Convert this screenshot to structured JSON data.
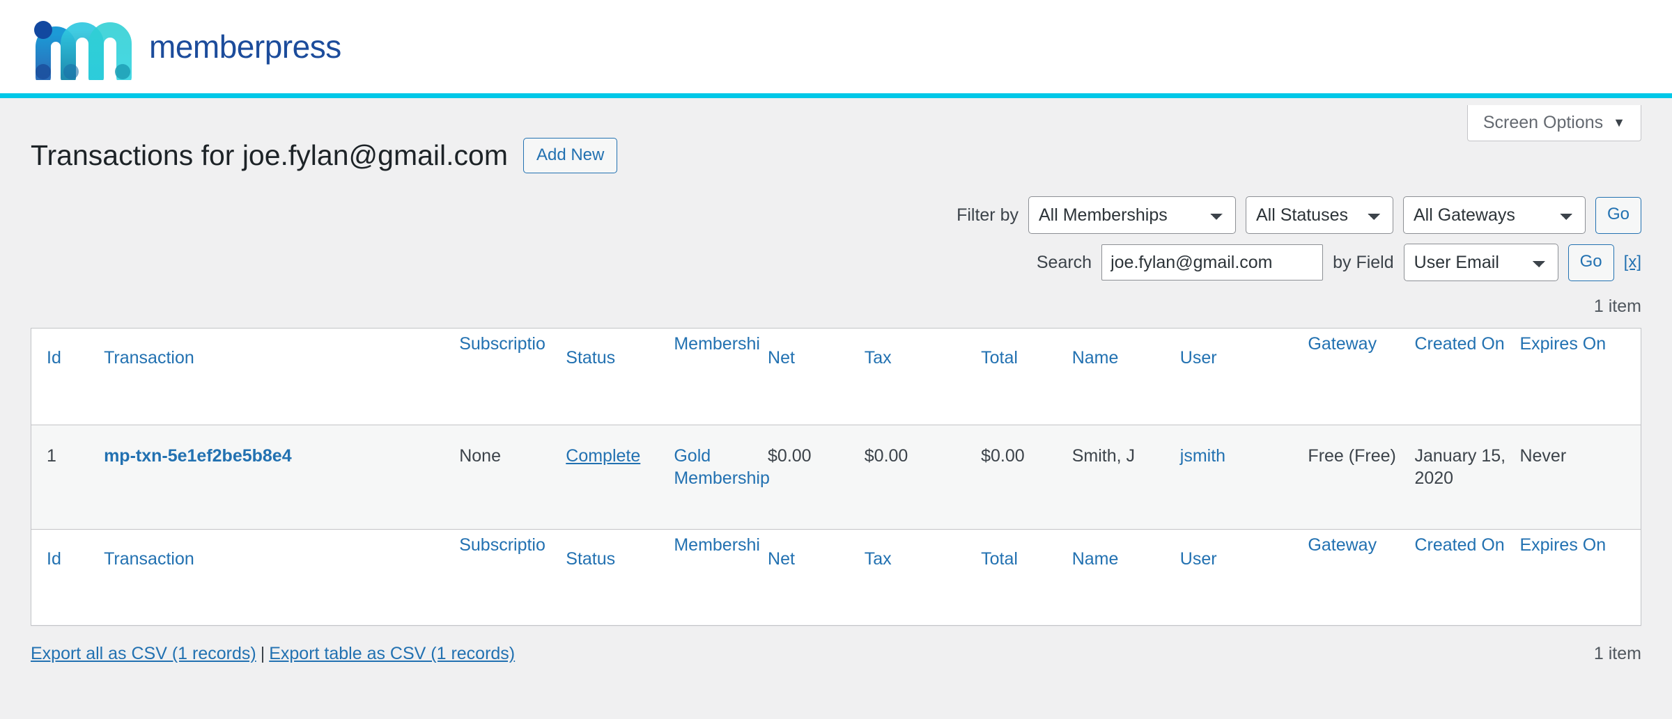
{
  "brand": {
    "name": "memberpress",
    "logo_icon": "memberpress-m-logo",
    "wordmark_color": "#1c4c9b",
    "rule_color": "#00c8e8"
  },
  "screen_options": {
    "label": "Screen Options",
    "caret": "▼"
  },
  "header": {
    "title": "Transactions for joe.fylan@gmail.com",
    "add_new_label": "Add New"
  },
  "filters": {
    "filter_by_label": "Filter by",
    "membership": {
      "value": "All Memberships",
      "options": [
        "All Memberships"
      ]
    },
    "status": {
      "value": "All Statuses",
      "options": [
        "All Statuses"
      ]
    },
    "gateway": {
      "value": "All Gateways",
      "options": [
        "All Gateways"
      ]
    },
    "go_label": "Go"
  },
  "search": {
    "label": "Search",
    "value": "joe.fylan@gmail.com",
    "placeholder": "",
    "by_field_label": "by Field",
    "field": {
      "value": "User Email",
      "options": [
        "User Email"
      ]
    },
    "go_label": "Go",
    "clear_label": "[x]"
  },
  "counts": {
    "top": "1 item",
    "bottom": "1 item"
  },
  "table": {
    "columns": [
      "Id",
      "Transaction",
      "Subscription",
      "Status",
      "Membership",
      "Net",
      "Tax",
      "Total",
      "Name",
      "User",
      "Gateway",
      "Created On",
      "Expires On"
    ],
    "columns_rendered": [
      "Id",
      "Transaction",
      "Subscriptio",
      "Status",
      "Membershi",
      "Net",
      "Tax",
      "Total",
      "Name",
      "User",
      "Gateway",
      "Created On",
      "Expires On"
    ],
    "rows": [
      {
        "id": "1",
        "transaction": "mp-txn-5e1ef2be5b8e4",
        "subscription": "None",
        "status": "Complete",
        "membership": "Gold Membership",
        "net": "$0.00",
        "tax": "$0.00",
        "total": "$0.00",
        "name": "Smith, J",
        "user": "jsmith",
        "gateway": "Free (Free)",
        "created_on": "January 15, 2020",
        "expires_on": "Never"
      }
    ]
  },
  "footer": {
    "export_all_label": "Export all as CSV (1 records)",
    "separator": "|",
    "export_table_label": "Export table as CSV (1 records)"
  },
  "colors": {
    "link": "#2271b1",
    "page_bg": "#f0f0f1",
    "row_bg": "#f6f7f7",
    "border": "#c3c4c7",
    "accent": "#00c8e8"
  }
}
